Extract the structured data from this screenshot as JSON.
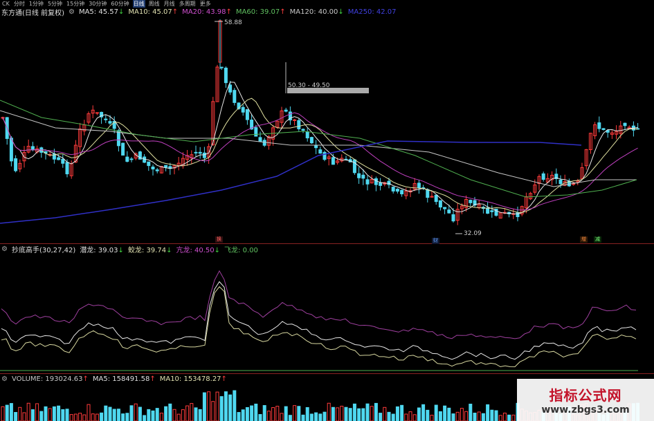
{
  "toolbar": {
    "items": [
      "分时",
      "1分钟",
      "5分钟",
      "15分钟",
      "30分钟",
      "60分钟",
      "日线",
      "周线",
      "月线",
      "多周期",
      "更多"
    ],
    "active_index": 6,
    "prefix": "CK"
  },
  "main_panel": {
    "stock_name": "东方通(日线 前复权)",
    "indicators": [
      {
        "label": "MA5: 45.57",
        "arrow": "↓",
        "color": "#e0e0e0"
      },
      {
        "label": "MA10: 45.07",
        "arrow": "↑",
        "color": "#e0e0b0"
      },
      {
        "label": "MA20: 43.98",
        "arrow": "↑",
        "color": "#d050d0"
      },
      {
        "label": "MA60: 39.07",
        "arrow": "↑",
        "color": "#60c060"
      },
      {
        "label": "MA120: 40.00",
        "arrow": "↓",
        "color": "#c8c8c8"
      },
      {
        "label": "MA250: 42.07",
        "arrow": "",
        "color": "#4040e0"
      }
    ],
    "high_label": "58.88",
    "low_label": "32.09",
    "range_label": "50.30 - 49.50",
    "markers": [
      {
        "text": "换",
        "color": "#ff6060",
        "bg": "#301010"
      },
      {
        "text": "财",
        "color": "#60a0ff",
        "bg": "#101830"
      },
      {
        "text": "增",
        "color": "#ff9040",
        "bg": "#301a08"
      },
      {
        "text": "减",
        "color": "#80ff80",
        "bg": "#082808"
      }
    ]
  },
  "sub_panel": {
    "title": "抄底高手(30,27,42)",
    "indicators": [
      {
        "label": "潜龙: 39.03",
        "arrow": "↓",
        "color": "#e0e0e0"
      },
      {
        "label": "蛟龙: 39.74",
        "arrow": "↓",
        "color": "#e0e0b0"
      },
      {
        "label": "亢龙: 40.50",
        "arrow": "↓",
        "color": "#d050d0"
      },
      {
        "label": "飞龙: 0.00",
        "arrow": "",
        "color": "#60c060"
      }
    ]
  },
  "volume_panel": {
    "indicators": [
      {
        "label": "VOLUME: 193024.63",
        "arrow": "↑",
        "color": "#c8c8c8"
      },
      {
        "label": "MA5: 158491.58",
        "arrow": "↑",
        "color": "#e0e0e0"
      },
      {
        "label": "MA10: 153478.27",
        "arrow": "↑",
        "color": "#e0e0b0"
      }
    ]
  },
  "watermark": {
    "title": "指标公式网",
    "url": "www.zbgs3.com"
  }
}
